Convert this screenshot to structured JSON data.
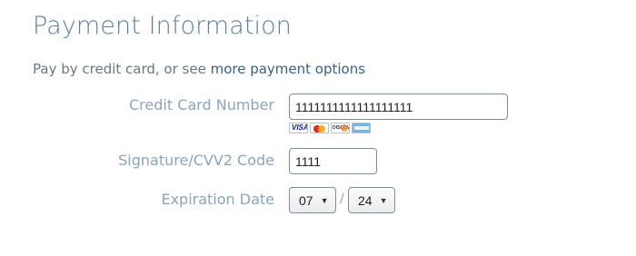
{
  "heading": "Payment Information",
  "subtitle": {
    "prefix": "Pay by credit card, or see ",
    "link": "more payment options"
  },
  "fields": {
    "card_number": {
      "label": "Credit Card Number",
      "value": "1111111111111111111"
    },
    "cvv": {
      "label": "Signature/CVV2 Code",
      "value": "1111"
    },
    "expiration": {
      "label": "Expiration Date",
      "month": "07",
      "year": "24",
      "separator": "/"
    }
  },
  "card_logos": {
    "visa": "VISA",
    "mastercard": "",
    "discover": "DISCOVER",
    "amex": ""
  },
  "colors": {
    "heading": "#5c7f9e",
    "label": "#8ca4ba",
    "link": "#3c5f7f"
  }
}
